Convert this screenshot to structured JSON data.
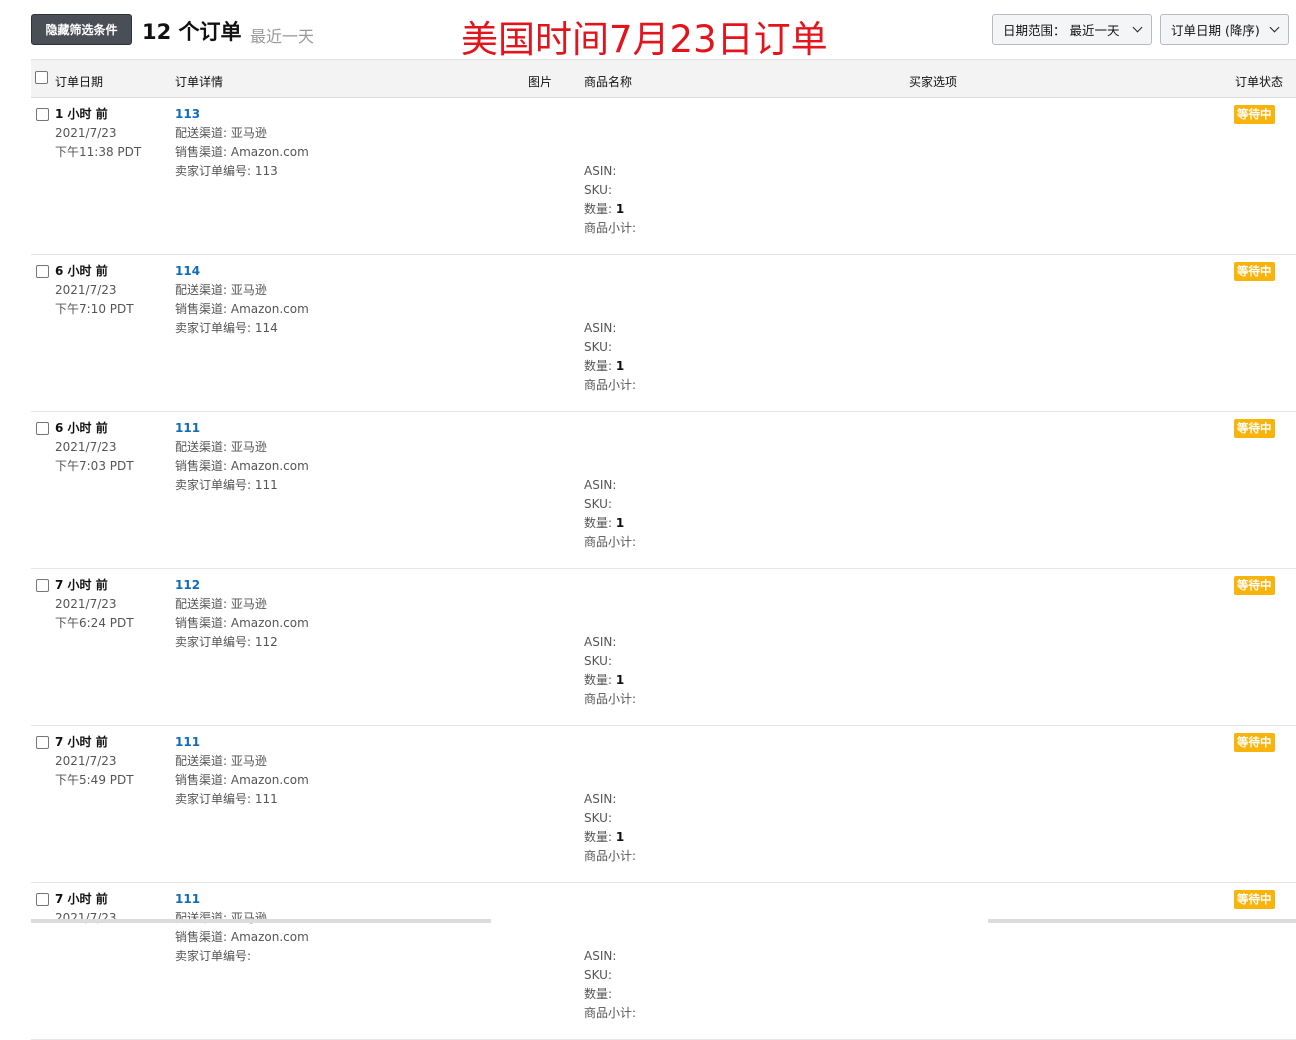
{
  "toolbar": {
    "hide_filters_label": "隐藏筛选条件",
    "order_count": "12 个订单",
    "range_text": "最近一天",
    "annotation": "美国时间7月23日订单",
    "date_range_dropdown": "日期范围： 最近一天",
    "sort_dropdown": "订单日期 (降序)"
  },
  "columns": {
    "order_date": "订单日期",
    "order_details": "订单详情",
    "image": "图片",
    "product_name": "商品名称",
    "buyer_options": "买家选项",
    "order_status": "订单状态"
  },
  "labels": {
    "channel": "配送渠道: 亚马逊",
    "sales_channel": "销售渠道: Amazon.com",
    "seller_order_prefix": "卖家订单编号: ",
    "asin": "ASIN:",
    "sku": "SKU:",
    "qty": "数量:",
    "subtotal": "商品小计:",
    "status_badge": "等待中"
  },
  "orders": [
    {
      "age": "1 小时 前",
      "date": "2021/7/23",
      "time": "下午11:38 PDT",
      "id": "113",
      "seller_order": "113",
      "qty": "1"
    },
    {
      "age": "6 小时 前",
      "date": "2021/7/23",
      "time": "下午7:10 PDT",
      "id": "114",
      "seller_order": "114",
      "qty": "1"
    },
    {
      "age": "6 小时 前",
      "date": "2021/7/23",
      "time": "下午7:03 PDT",
      "id": "111",
      "seller_order": "111",
      "qty": "1"
    },
    {
      "age": "7 小时 前",
      "date": "2021/7/23",
      "time": "下午6:24 PDT",
      "id": "112",
      "seller_order": "112",
      "qty": "1"
    },
    {
      "age": "7 小时 前",
      "date": "2021/7/23",
      "time": "下午5:49 PDT",
      "id": "111",
      "seller_order": "111",
      "qty": "1"
    },
    {
      "age": "7 小时 前",
      "date": "2021/7/23",
      "time": "",
      "id": "111",
      "seller_order": "",
      "qty": ""
    }
  ],
  "colors": {
    "accent_link": "#0f6cbd",
    "badge": "#f9b40c",
    "annotation": "#e5141c"
  }
}
